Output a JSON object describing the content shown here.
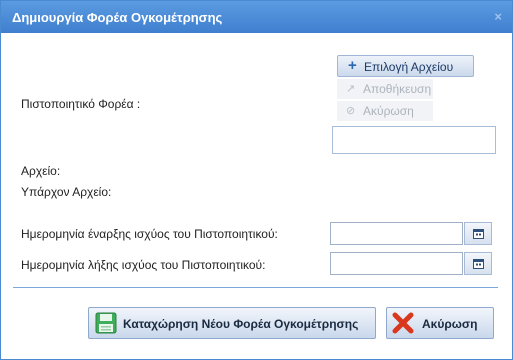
{
  "dialog": {
    "title": "Δημιουργία Φορέα Ογκομέτρησης",
    "close_glyph": "×"
  },
  "form": {
    "certificate_label": "Πιστοποιητικό Φορέα :",
    "file_label": "Αρχείο:",
    "existing_file_label": "Υπάρχον Αρχείο:",
    "start_date_label": "Ημερομηνία έναρξης ισχύος του Πιστοποιητικού:",
    "end_date_label": "Ημερομηνία λήξης ισχύος του Πιστοποιητικού:",
    "start_date_value": "",
    "end_date_value": ""
  },
  "upload": {
    "select_file": "Επιλογή Αρχείου",
    "save": "Αποθήκευση",
    "cancel": "Ακύρωση",
    "filename": ""
  },
  "actions": {
    "submit": "Καταχώρηση Νέου Φορέα Ογκομέτρησης",
    "cancel": "Ακύρωση"
  },
  "colors": {
    "titlebar": "#4a8ad0",
    "accent": "#2a67b0",
    "save_icon": "#3fae5c",
    "cancel_icon": "#d9381e"
  },
  "icons": {
    "close": "close-icon",
    "select_file": "plus-icon",
    "save": "upload-arrow-icon",
    "cancel_upload": "ban-icon",
    "date": "calendar-icon",
    "submit": "floppy-disk-icon",
    "cancel": "red-x-icon"
  }
}
